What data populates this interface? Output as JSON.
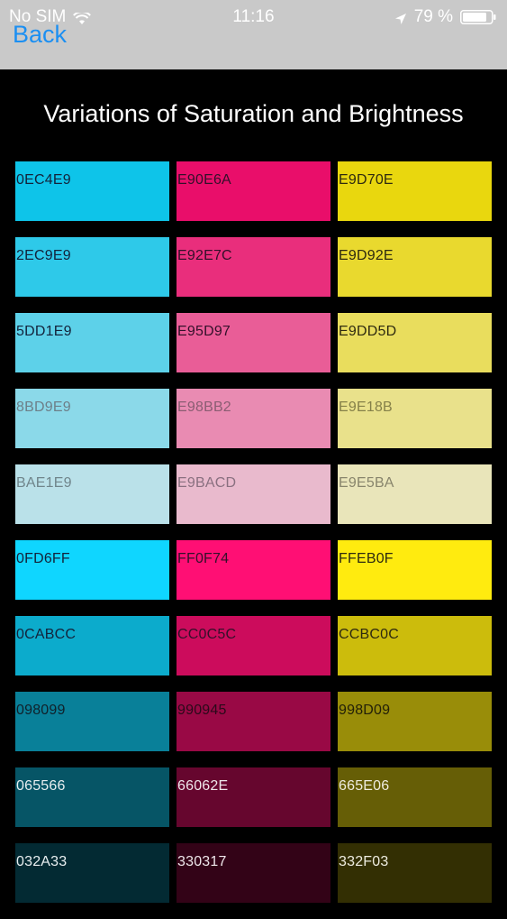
{
  "status_bar": {
    "carrier": "No SIM",
    "time": "11:16",
    "battery": "79 %",
    "wifi_icon": "wifi-icon",
    "location_icon": "location-arrow-icon",
    "battery_icon": "battery-icon"
  },
  "nav": {
    "back_label": "Back",
    "background": "#c9c9c9",
    "accent": "#1b8ff2"
  },
  "title": "Variations of Saturation and Brightness",
  "rows": [
    [
      {
        "label": "0EC4E9",
        "color": "#0EC4E9",
        "text_color": "#13233b"
      },
      {
        "label": "E90E6A",
        "color": "#E90E6A",
        "text_color": "#33102a"
      },
      {
        "label": "E9D70E",
        "color": "#E9D70E",
        "text_color": "#2e2a10"
      }
    ],
    [
      {
        "label": "2EC9E9",
        "color": "#2EC9E9",
        "text_color": "#13233b"
      },
      {
        "label": "E92E7C",
        "color": "#E92E7C",
        "text_color": "#33102a"
      },
      {
        "label": "E9D92E",
        "color": "#E9D92E",
        "text_color": "#2e2a10"
      }
    ],
    [
      {
        "label": "5DD1E9",
        "color": "#5DD1E9",
        "text_color": "#13233b"
      },
      {
        "label": "E95D97",
        "color": "#E95D97",
        "text_color": "#33102a"
      },
      {
        "label": "E9DD5D",
        "color": "#E9DD5D",
        "text_color": "#2e2a10"
      }
    ],
    [
      {
        "label": "8BD9E9",
        "color": "#8BD9E9",
        "text_color": "#6d7f88"
      },
      {
        "label": "E98BB2",
        "color": "#E98BB2",
        "text_color": "#8a5d72"
      },
      {
        "label": "E9E18B",
        "color": "#E9E18B",
        "text_color": "#858049"
      }
    ],
    [
      {
        "label": "BAE1E9",
        "color": "#BAE1E9",
        "text_color": "#70858b"
      },
      {
        "label": "E9BACD",
        "color": "#E9BACD",
        "text_color": "#8a7080"
      },
      {
        "label": "E9E5BA",
        "color": "#E9E5BA",
        "text_color": "#88856c"
      }
    ],
    [
      {
        "label": "0FD6FF",
        "color": "#0FD6FF",
        "text_color": "#13233b"
      },
      {
        "label": "FF0F74",
        "color": "#FF0F74",
        "text_color": "#33102a"
      },
      {
        "label": "FFEB0F",
        "color": "#FFEB0F",
        "text_color": "#2e2a10"
      }
    ],
    [
      {
        "label": "0CABCC",
        "color": "#0CABCC",
        "text_color": "#13233b"
      },
      {
        "label": "CC0C5C",
        "color": "#CC0C5C",
        "text_color": "#33102a"
      },
      {
        "label": "CCBC0C",
        "color": "#CCBC0C",
        "text_color": "#2e2a10"
      }
    ],
    [
      {
        "label": "098099",
        "color": "#098099",
        "text_color": "#10202a"
      },
      {
        "label": "990945",
        "color": "#990945",
        "text_color": "#2a0a1a"
      },
      {
        "label": "998D09",
        "color": "#998D09",
        "text_color": "#232008"
      }
    ],
    [
      {
        "label": "065566",
        "color": "#065566",
        "text_color": "#e8eef0"
      },
      {
        "label": "66062E",
        "color": "#66062E",
        "text_color": "#eee6ea"
      },
      {
        "label": "665E06",
        "color": "#665E06",
        "text_color": "#eeece0"
      }
    ],
    [
      {
        "label": "032A33",
        "color": "#032A33",
        "text_color": "#e8eef0"
      },
      {
        "label": "330317",
        "color": "#330317",
        "text_color": "#eee6ea"
      },
      {
        "label": "332F03",
        "color": "#332F03",
        "text_color": "#eeece0"
      }
    ]
  ]
}
